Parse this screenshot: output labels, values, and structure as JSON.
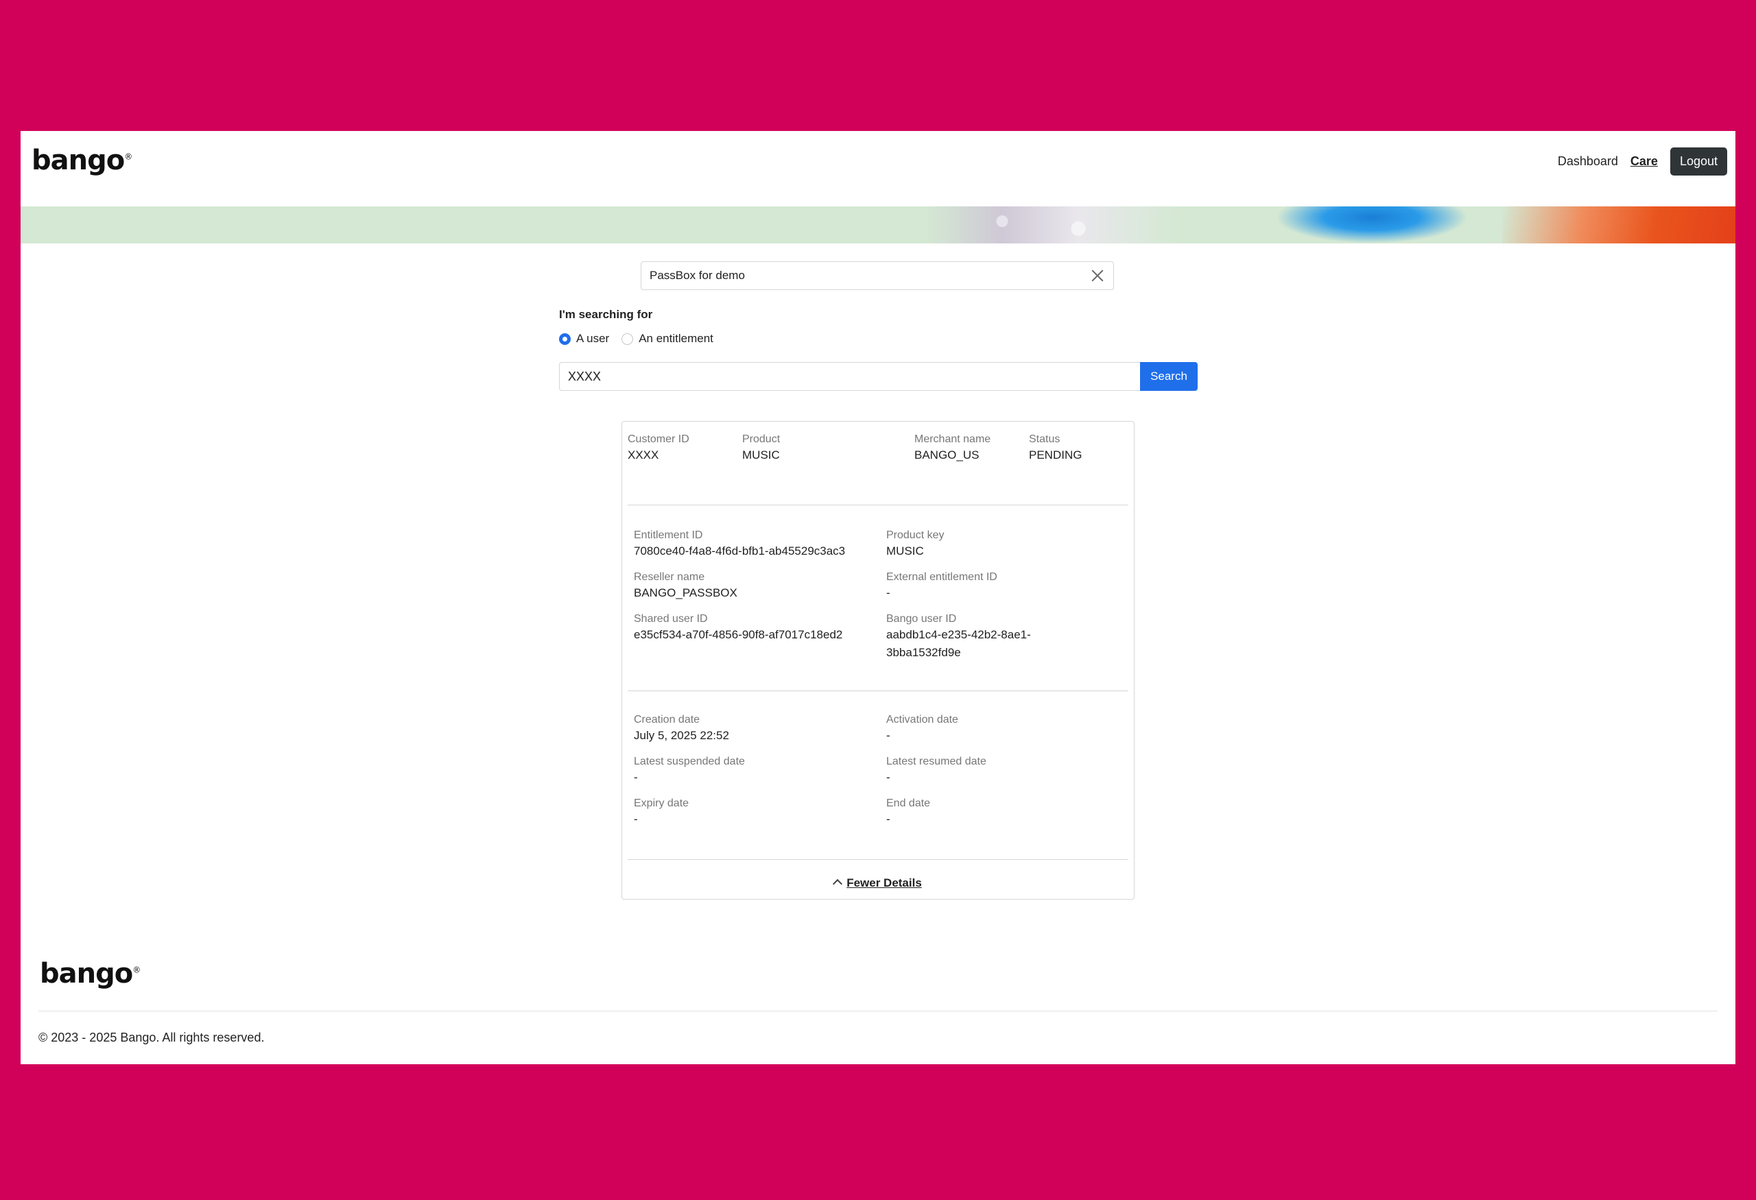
{
  "header": {
    "logo": "bango",
    "nav": {
      "dashboard": "Dashboard",
      "care": "Care",
      "logout": "Logout"
    }
  },
  "product_select": {
    "value": "PassBox for demo"
  },
  "search": {
    "label": "I'm searching for",
    "options": {
      "user": "A user",
      "entitlement": "An entitlement"
    },
    "selected": "A user",
    "query": "XXXX",
    "button": "Search"
  },
  "result": {
    "summary": {
      "customer_id_label": "Customer ID",
      "customer_id": "XXXX",
      "product_label": "Product",
      "product": "MUSIC",
      "merchant_label": "Merchant name",
      "merchant": "BANGO_US",
      "status_label": "Status",
      "status": "PENDING"
    },
    "ids": {
      "entitlement_id_label": "Entitlement ID",
      "entitlement_id": "7080ce40-f4a8-4f6d-bfb1-ab45529c3ac3",
      "product_key_label": "Product key",
      "product_key": "MUSIC",
      "reseller_label": "Reseller name",
      "reseller": "BANGO_PASSBOX",
      "external_id_label": "External entitlement ID",
      "external_id": "-",
      "shared_user_label": "Shared user ID",
      "shared_user": "e35cf534-a70f-4856-90f8-af7017c18ed2",
      "bango_user_label": "Bango user ID",
      "bango_user_1": "aabdb1c4-e235-42b2-8ae1-",
      "bango_user_2": "3bba1532fd9e"
    },
    "dates": {
      "creation_label": "Creation date",
      "creation": "July 5, 2025 22:52",
      "activation_label": "Activation date",
      "activation": "-",
      "suspended_label": "Latest suspended date",
      "suspended": "-",
      "resumed_label": "Latest resumed date",
      "resumed": "-",
      "expiry_label": "Expiry date",
      "expiry": "-",
      "end_label": "End date",
      "end": "-"
    },
    "fewer_details": "Fewer Details"
  },
  "footer": {
    "logo": "bango",
    "copyright": "© 2023 - 2025 Bango. All rights reserved."
  },
  "colors": {
    "page_bg": "#d10059",
    "accent": "#1f6feb",
    "logout_bg": "#2f3437"
  }
}
